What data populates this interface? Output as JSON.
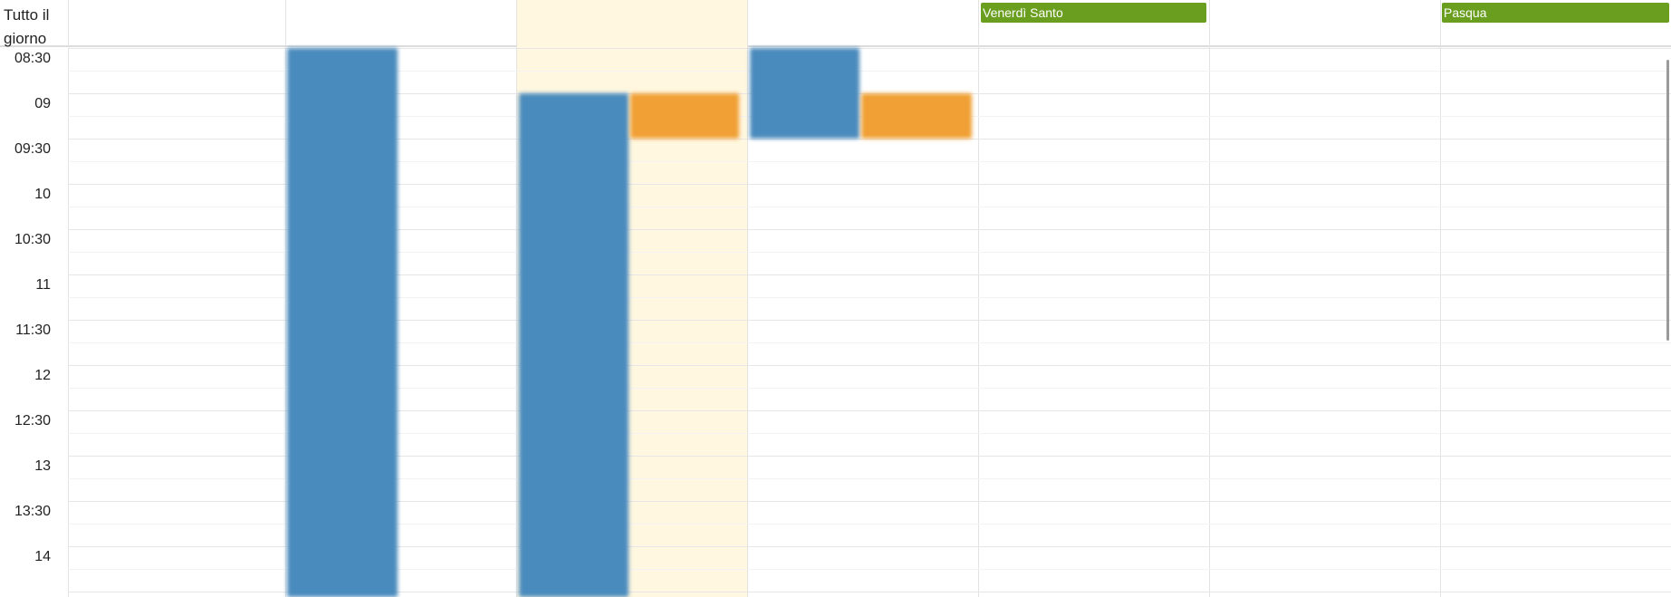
{
  "allday": {
    "label": "Tutto il giorno"
  },
  "allday_events": [
    {
      "title": "Venerdì Santo",
      "color": "#6a9e1f"
    },
    {
      "title": "Pasqua",
      "color": "#6a9e1f"
    }
  ],
  "time_labels": [
    "08:30",
    "09",
    "09:30",
    "10",
    "10:30",
    "11",
    "11:30",
    "12",
    "12:30",
    "13",
    "13:30",
    "14"
  ],
  "colors": {
    "event_blue": "#4a8bbd",
    "event_orange": "#f0a035",
    "today_bg": "#fff7e0",
    "holiday_green": "#6a9e1f"
  }
}
